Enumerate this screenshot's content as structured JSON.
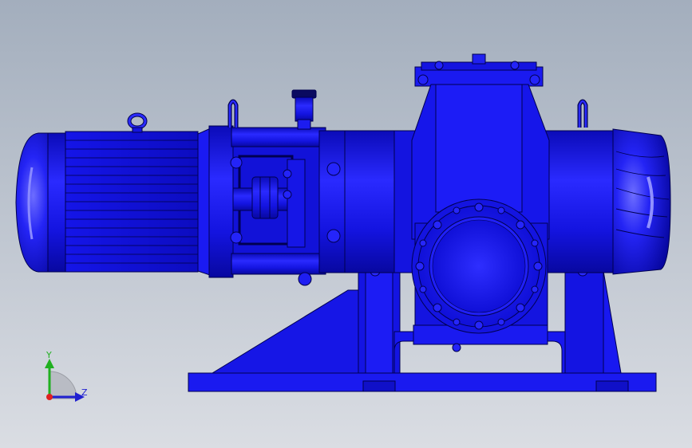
{
  "viewport": {
    "background_top": "#a3aebd",
    "background_bottom": "#dadde3"
  },
  "model": {
    "fill_color": "#1717ee",
    "edge_color": "#000050",
    "highlight_color": "#6f6ff8"
  },
  "triad": {
    "y_label": "Y",
    "z_label": "Z",
    "y_color": "#20b020",
    "z_color": "#2020d0",
    "x_color": "#e02020"
  }
}
